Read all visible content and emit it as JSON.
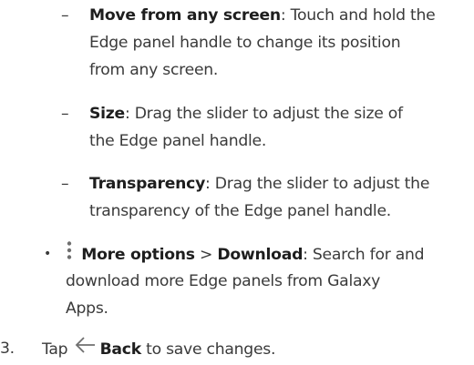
{
  "items": [
    {
      "marker": "–",
      "title": "Move from any screen",
      "lines": [
        ": Touch and hold the",
        "Edge panel handle to change its position",
        "from any screen."
      ]
    },
    {
      "marker": "–",
      "title": "Size",
      "lines": [
        ": Drag the slider to adjust the size of",
        "the Edge panel handle."
      ]
    },
    {
      "marker": "–",
      "title": "Transparency",
      "lines": [
        ": Drag the slider to adjust the",
        "transparency of the Edge panel handle."
      ]
    }
  ],
  "bullet": {
    "marker": "•",
    "icon": "more-options-icon",
    "title": "More options",
    "separator": " > ",
    "title2": "Download",
    "lines": [
      ": Search for and",
      "download more Edge panels from Galaxy",
      "Apps."
    ]
  },
  "step": {
    "number": "3.",
    "prefix": "Tap ",
    "icon": "back-icon",
    "title": "Back",
    "suffix": " to save changes."
  },
  "colors": {
    "text": "#3a3a3a",
    "bold": "#1e1e1e",
    "icon": "#6f6f6f"
  }
}
